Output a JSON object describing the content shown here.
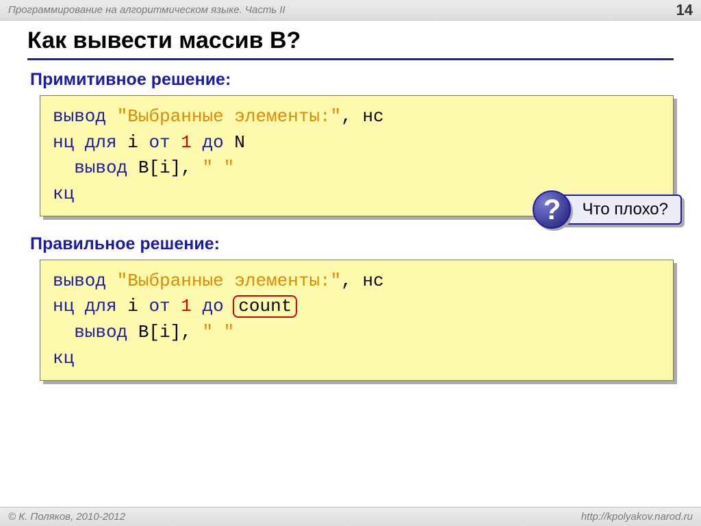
{
  "header": {
    "subject": "Программирование на алгоритмическом языке. Часть II",
    "page": "14"
  },
  "title": "Как вывести массив B?",
  "section1": {
    "label": "Примитивное решение:",
    "code": {
      "l1_a": "вывод ",
      "l1_b": "\"Выбранные элементы:\"",
      "l1_c": ", нс",
      "l2_a": "нц для ",
      "l2_b": "i ",
      "l2_c": "от ",
      "l2_d": "1",
      "l2_e": " до ",
      "l2_f": "N",
      "l3_a": "  вывод ",
      "l3_b": "B[i], ",
      "l3_c": "\" \"",
      "l4_a": "кц"
    }
  },
  "callout": {
    "symbol": "?",
    "text": "Что плохо?"
  },
  "section2": {
    "label": "Правильное решение:",
    "code": {
      "l1_a": "вывод ",
      "l1_b": "\"Выбранные элементы:\"",
      "l1_c": ", нс",
      "l2_a": "нц для ",
      "l2_b": "i ",
      "l2_c": "от ",
      "l2_d": "1",
      "l2_e": " до ",
      "l2_f": "count",
      "l3_a": "  вывод ",
      "l3_b": "B[i], ",
      "l3_c": "\" \"",
      "l4_a": "кц"
    }
  },
  "footer": {
    "copyright": "© К. Поляков, 2010-2012",
    "url": "http://kpolyakov.narod.ru"
  }
}
